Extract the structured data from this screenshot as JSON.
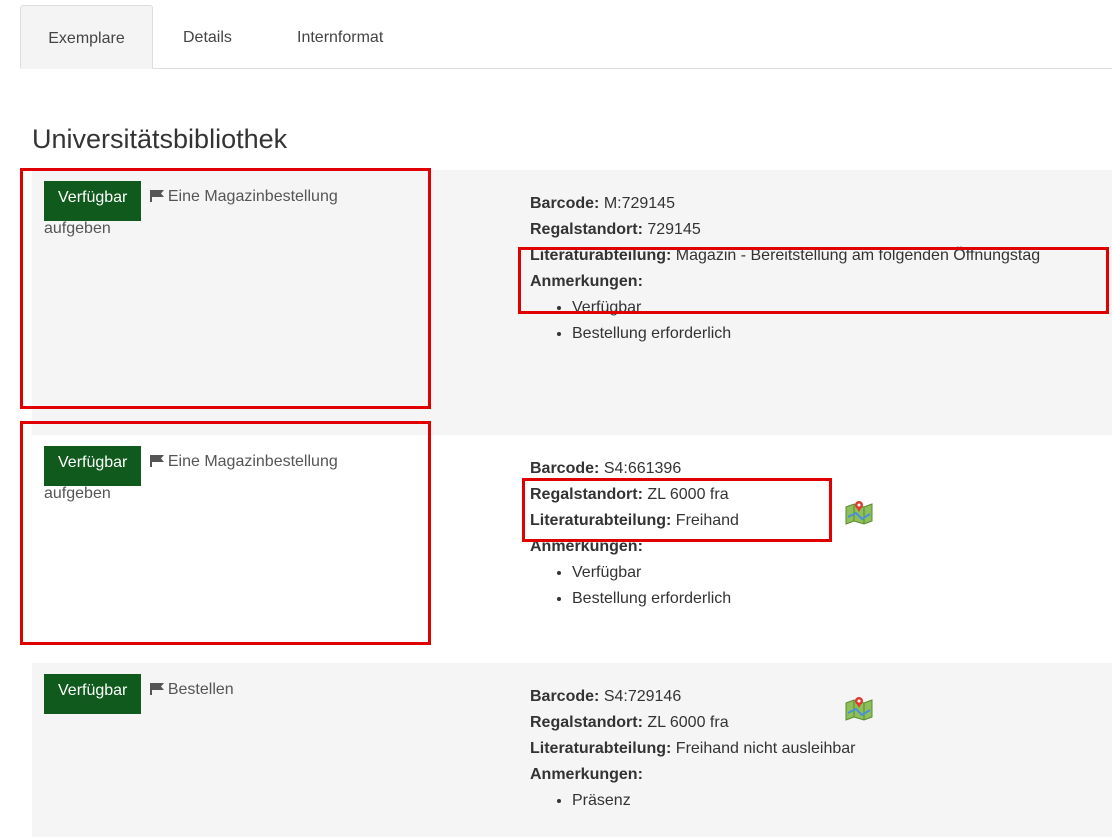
{
  "tabs": [
    {
      "label": "Exemplare",
      "active": true
    },
    {
      "label": "Details",
      "active": false
    },
    {
      "label": "Internformat",
      "active": false
    }
  ],
  "library_title": "Universitätsbibliothek",
  "labels": {
    "barcode": "Barcode:",
    "shelf": "Regalstandort:",
    "department": "Literaturabteilung:",
    "notes": "Anmerkungen:"
  },
  "items": [
    {
      "status": "Verfügbar",
      "action_part1": "Eine Magazinbestellung",
      "action_part2": "aufgeben",
      "barcode": "M:729145",
      "shelf": "729145",
      "department": "Magazin - Bereitstellung am folgenden Öffnungstag",
      "notes": [
        "Verfügbar",
        "Bestellung erforderlich"
      ]
    },
    {
      "status": "Verfügbar",
      "action_part1": "Eine Magazinbestellung",
      "action_part2": "aufgeben",
      "barcode": "S4:661396",
      "shelf": "ZL 6000 fra",
      "department": "Freihand",
      "notes": [
        "Verfügbar",
        "Bestellung erforderlich"
      ]
    },
    {
      "status": "Verfügbar",
      "action_part1": "Bestellen",
      "action_part2": "",
      "barcode": "S4:729146",
      "shelf": "ZL 6000 fra",
      "department": "Freihand nicht ausleihbar",
      "notes": [
        "Präsenz"
      ]
    }
  ],
  "colors": {
    "status_badge": "#0f5a1c",
    "highlight": "#e00000",
    "row_shade": "#f5f5f5"
  },
  "icons": {
    "action": "flag-icon",
    "location": "map-icon"
  }
}
